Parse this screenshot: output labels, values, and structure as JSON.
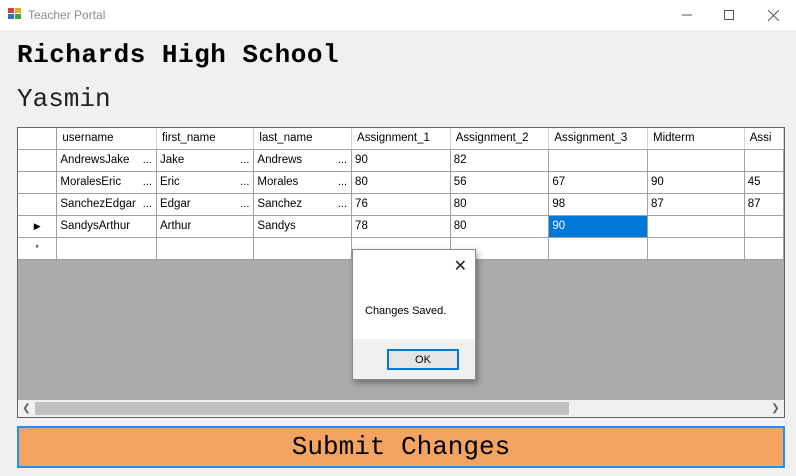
{
  "window": {
    "title": "Teacher Portal"
  },
  "header": {
    "school": "Richards High School",
    "student": "Yasmin"
  },
  "grid": {
    "columns": [
      "username",
      "first_name",
      "last_name",
      "Assignment_1",
      "Assignment_2",
      "Assignment_3",
      "Midterm",
      "Assi"
    ],
    "rows": [
      [
        "AndrewsJake",
        "Jake",
        "Andrews",
        "90",
        "82",
        "",
        "",
        ""
      ],
      [
        "MoralesEric",
        "Eric",
        "Morales",
        "80",
        "56",
        "67",
        "90",
        "45"
      ],
      [
        "SanchezEdgar",
        "Edgar",
        "Sanchez",
        "76",
        "80",
        "98",
        "87",
        "87"
      ],
      [
        "SandysArthur",
        "Arthur",
        "Sandys",
        "78",
        "80",
        "90",
        "",
        ""
      ]
    ],
    "current_row_marker": "▶",
    "new_row_marker": "*",
    "ellipsis": "..."
  },
  "dialog": {
    "close": "✕",
    "message": "Changes Saved.",
    "ok_label": "OK"
  },
  "submit": {
    "label": "Submit Changes"
  },
  "colors": {
    "submit_bg": "#f4a460",
    "submit_border": "#1e90ff",
    "selection": "#0078d7"
  }
}
